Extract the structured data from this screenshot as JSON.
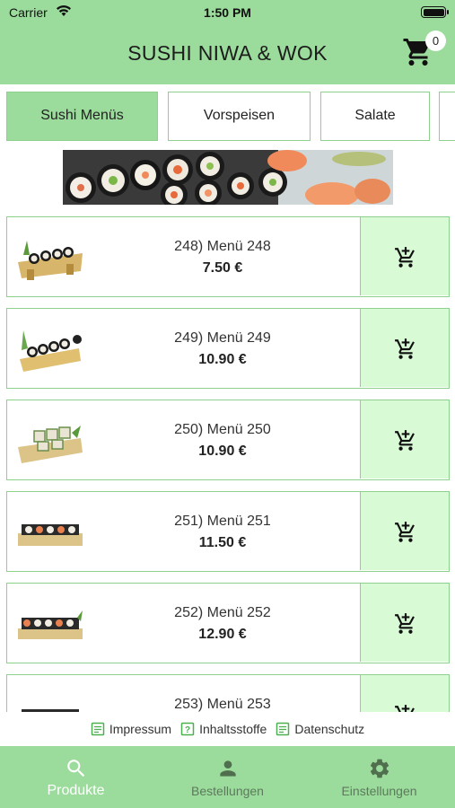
{
  "status": {
    "carrier": "Carrier",
    "time": "1:50 PM"
  },
  "header": {
    "title": "SUSHI NIWA & WOK",
    "cart_count": "0"
  },
  "categories": [
    {
      "label": "Sushi Menüs",
      "active": true
    },
    {
      "label": "Vorspeisen",
      "active": false
    },
    {
      "label": "Salate",
      "active": false
    }
  ],
  "products": [
    {
      "name": "248) Menü 248",
      "price": "7.50 €"
    },
    {
      "name": "249) Menü 249",
      "price": "10.90 €"
    },
    {
      "name": "250) Menü 250",
      "price": "10.90 €"
    },
    {
      "name": "251) Menü 251",
      "price": "11.50 €"
    },
    {
      "name": "252) Menü 252",
      "price": "12.90 €"
    },
    {
      "name": "253) Menü 253",
      "price": ""
    }
  ],
  "footer_links": {
    "impressum": "Impressum",
    "inhaltsstoffe": "Inhaltsstoffe",
    "datenschutz": "Datenschutz"
  },
  "tabbar": {
    "produkte": "Produkte",
    "bestellungen": "Bestellungen",
    "einstellungen": "Einstellungen"
  },
  "colors": {
    "brand_green": "#9bdb9b",
    "border_green": "#8ed18e",
    "cart_bg": "#d8fbd6"
  }
}
